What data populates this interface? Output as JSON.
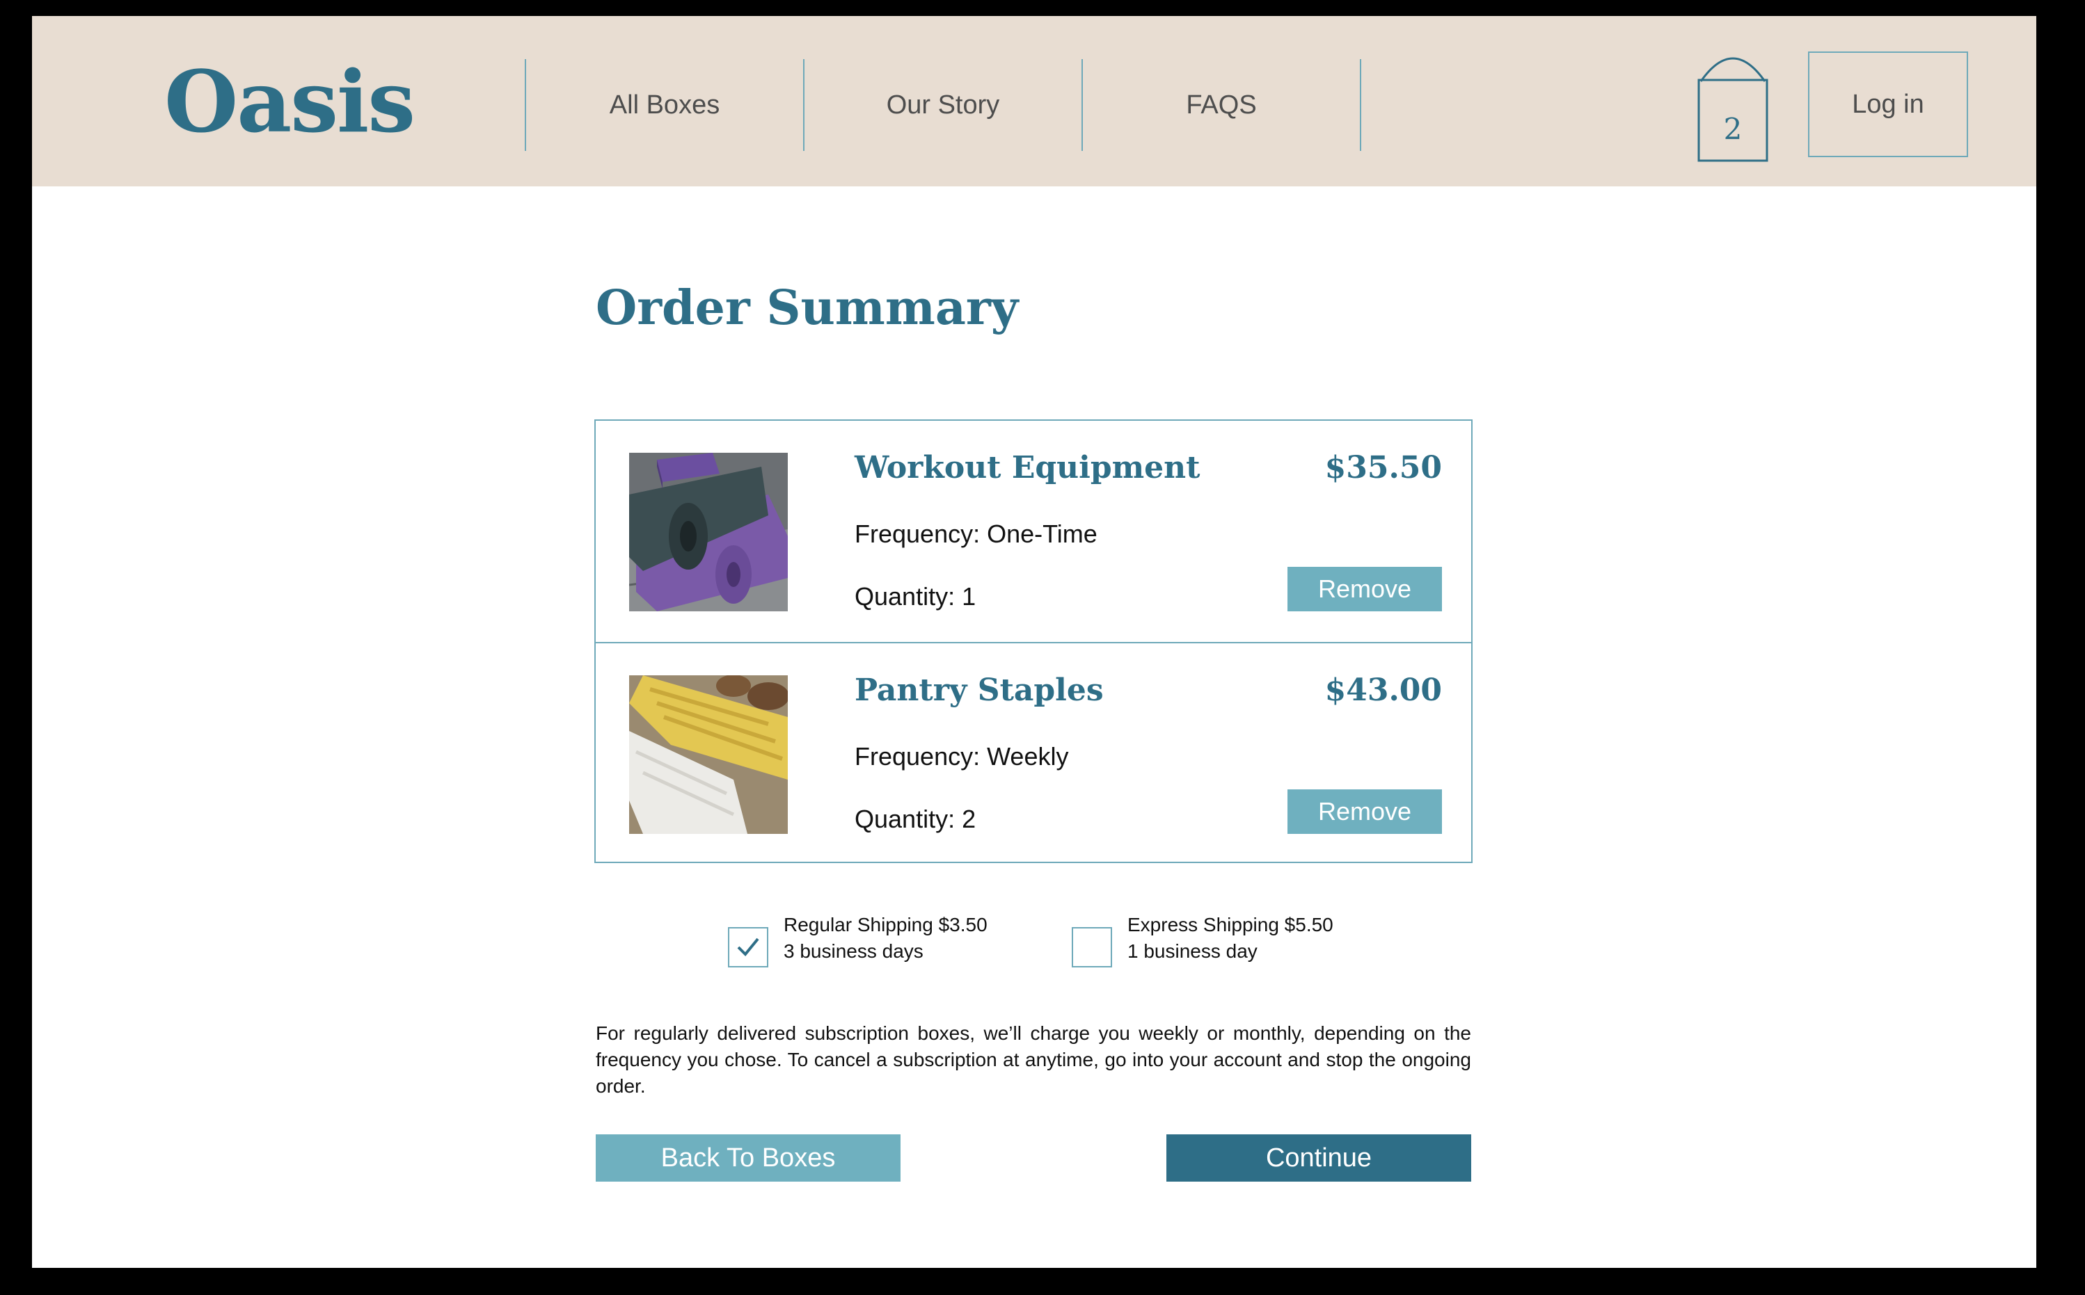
{
  "brand": {
    "name": "Oasis"
  },
  "nav": {
    "items": [
      {
        "label": "All Boxes"
      },
      {
        "label": "Our Story"
      },
      {
        "label": "FAQS"
      }
    ],
    "cart_count": "2",
    "login_label": "Log in"
  },
  "page": {
    "title": "Order Summary"
  },
  "orders": [
    {
      "name": "Workout Equipment",
      "price": "$35.50",
      "frequency": "Frequency: One-Time",
      "quantity": "Quantity: 1",
      "remove_label": "Remove"
    },
    {
      "name": "Pantry Staples",
      "price": "$43.00",
      "frequency": "Frequency: Weekly",
      "quantity": "Quantity: 2",
      "remove_label": "Remove"
    }
  ],
  "shipping": {
    "regular": {
      "label": "Regular Shipping $3.50",
      "detail": "3 business days",
      "checked": true
    },
    "express": {
      "label": "Express Shipping $5.50",
      "detail": "1 business day",
      "checked": false
    }
  },
  "note": "For regularly delivered subscription boxes, we’ll charge you weekly or monthly, depending on the frequency you chose. To cancel a subscription at anytime, go into your account and stop the ongoing order.",
  "buttons": {
    "back_label": "Back To Boxes",
    "continue_label": "Continue"
  },
  "colors": {
    "brand": "#2e6e87",
    "accent": "#6fb0bf",
    "header_bg": "#e8ddd2",
    "border": "#6ea9b9"
  },
  "icons": {
    "cart": "shopping-bag-icon",
    "check": "checkmark-icon"
  }
}
